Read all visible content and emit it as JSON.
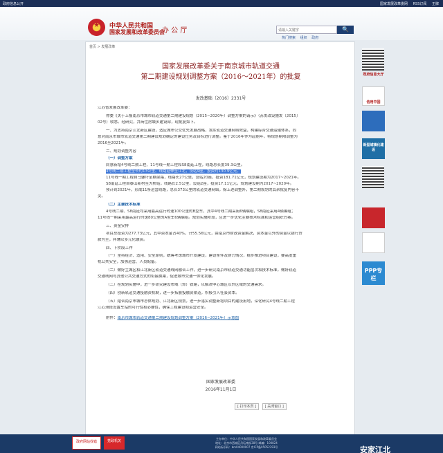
{
  "topbar": {
    "left": "政府信息公开",
    "right": [
      "国家发展改革委网",
      "RSS订阅",
      "王牌"
    ]
  },
  "header": {
    "agency_line1": "中华人民共和国",
    "agency_line2": "国家发展和改革委员会",
    "office": "办 公 厅",
    "search_placeholder": "请输入关键字",
    "search_button": "🔍",
    "quicklinks": [
      "热门搜索",
      "组织",
      "政府"
    ]
  },
  "breadcrumb": "首页 > 发展改革",
  "title_line1": "国家发展改革委关于南京城市轨道交通",
  "title_line2": "第二期建设规划调整方案（2016～2021年）的批复",
  "doc_no": "发改基础〔2016〕2331号",
  "recipient": "江苏省发展改革委：",
  "body": [
    "你委《关于上报南京市城市轨道交通第二期建设规划（2015~2020年）调整方案的请示》（苏发改设施发〔2015〕",
    "02号）收悉。经研究，并商住房城乡建设部，现批复如下。",
    "一、为支持南京江北新区建设，适应城市公交优先发展战略，发挥轨道交通网络效益，构建综合交通运输体系，同",
    "意对南京市城市轨道交通第二期建设规划确定的建设任务及目标进行调整。鉴于2016年作为起始年，将规划期限调整为",
    "2016至2021年。",
    "二、规划调整内容",
    "（一）调整方案",
    "同意新增4号线二期工程、11号线一期工程和S8南延工程，线路总长度39.3公里。",
    "4号线二期工程全长约13公里。线路延伸至江北，设站9座，投资约130.9亿元。",
    "11号线一期工程自马骡圩至横梁路，线路长27公里，设站20座，投资181.71亿元，规划建设期为2017~2021年。",
    "S8南延工程自泰山新村至大桥站，线路长2.5公里，设站2座，投资17.11亿元，规划建设期为2017~2020年。",
    "预计到2021年，形成11条运营线路，总长373公里的轨道交通网络，除上述调整外，第二期规划的其余批复内容不",
    "变。",
    "（二）主要技术标准",
    "4号线二期、S8南延均采用最高运行时速100公里的B型车，其中4号线二期采用6辆编组，S8南延采用4辆编组；",
    "11号线一期采用最高运行时速80公里的A型车6辆编组。规划实施阶段，应进一步优化主要技术标准和运营组织方案。",
    "三、资金安排",
    "项目总投资为277.73亿元，其中资本金占40%，计55.56亿元，由南京市财政资金解决，资本金以外的资金以银行贷",
    "款为主，并辅以多元化融资。",
    "四、下阶段工作",
    "（一）坚持经济、适用、安全原则，统筹考虑城市开发建设，建设条件及财力情况，稳步推进项目建设，要高度重",
    "视公共安全，加强运营、人员配备。",
    "（二）做好主城区和江北新区轨道交通线网融合工作，进一步研究南京市轨道交通功能层次和技术标准，做好轨道",
    "交通线网与其他公共交通方式的衔接换乘，促进城市交通一体化发展。",
    "（三）在规划实施中，进一步研究建设市域（郊）铁路，以解决中心城区以外区域的交通需求。",
    "（四）创新轨道交通投融资机制，进一步拓展投融资渠道，积极引入社会资本。",
    "（五）结合南京市城市总体规划、江北新区规划，进一步落实调整新增项目的建设用地，深化研究4号线二期工程",
    "江心洲段设置车站的可行性和必要性，确保工程建设和运营安全。"
  ],
  "attachment_label": "附件：",
  "attachment_link": "南京市城市轨道交通第二期建设规划调整方案（2016~2021年）示意图",
  "signature": "国家发展改革委",
  "date": "2016年11月1日",
  "buttons": [
    "[ 打印本页 ]",
    "[ 关闭窗口 ]"
  ],
  "rail": [
    "政府信息大厅",
    "信用中国",
    "",
    "新型城镇化建设",
    "",
    "国家发展改革委微信",
    "中国价格举报网站",
    "PPP专栏"
  ],
  "footer": {
    "b1": "政府网站找错",
    "b2": "党政机关",
    "lines": [
      "主办单位：中华人民共和国国家发展和改革委员会",
      "地址：北京市西城区月坛南街38号 邮编：100824",
      "网站标识码：bm04000007 京ICP备05052393号"
    ]
  },
  "brand": "安家江北"
}
